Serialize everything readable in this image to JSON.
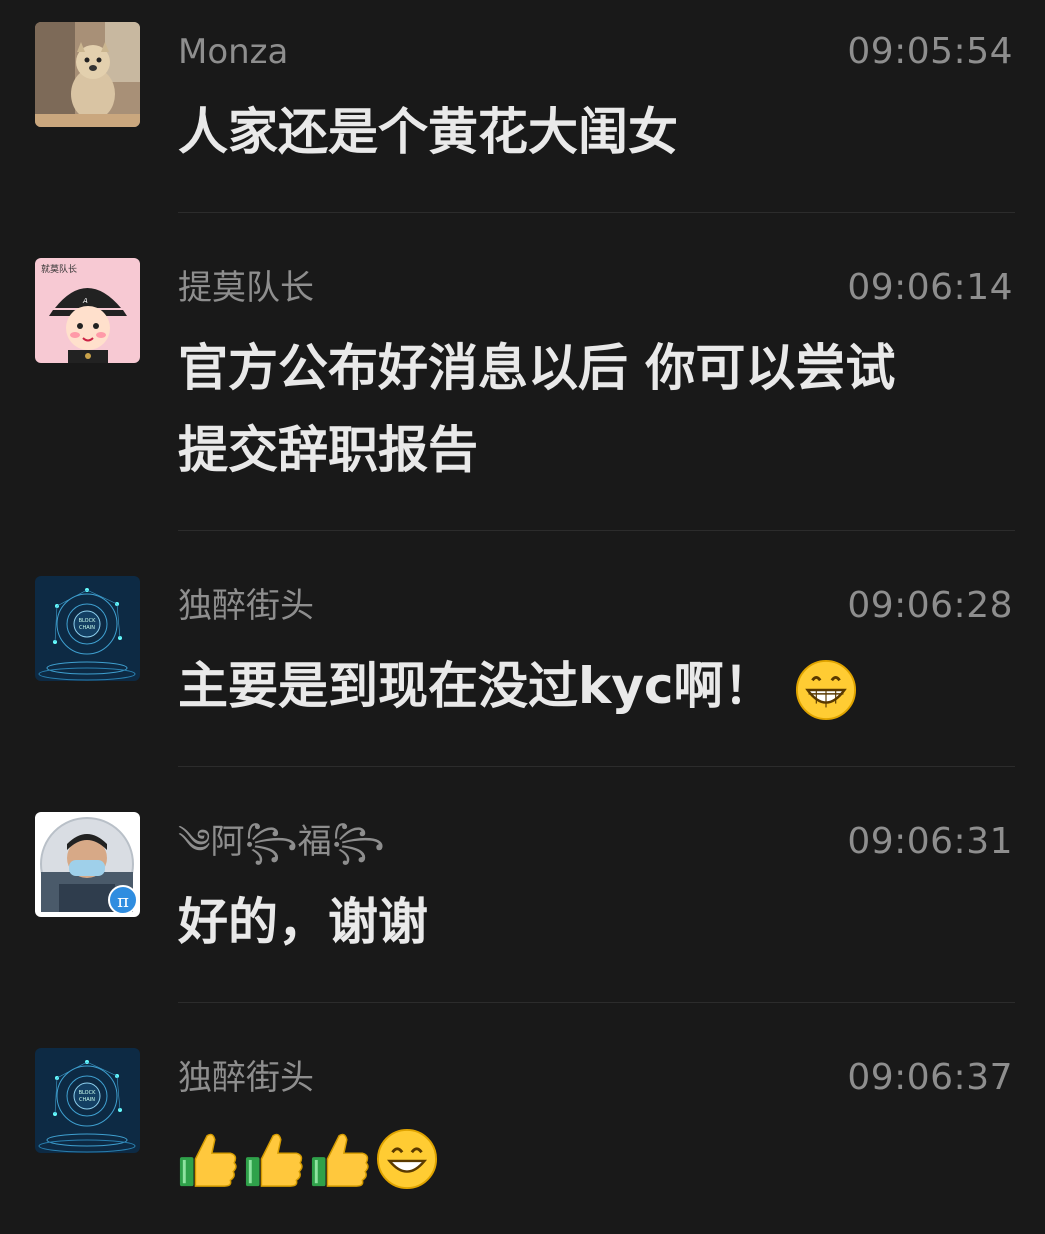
{
  "messages": [
    {
      "name": "Monza",
      "time": "09:05:54",
      "text": "人家还是个黄花大闺女",
      "avatar_icon": "dog-photo-avatar"
    },
    {
      "name": "提莫队长",
      "time": "09:06:14",
      "text_line1": "官方公布好消息以后 你可以尝试",
      "text_line2": "提交辞职报告",
      "avatar_icon": "cartoon-boy-avatar",
      "avatar_label": "就莫队长"
    },
    {
      "name": "独醉街头",
      "time": "09:06:28",
      "text": "主要是到现在没过kyc啊！",
      "emoji": "grinning-face-icon",
      "avatar_icon": "blockchain-avatar",
      "avatar_label_1": "BLOCK",
      "avatar_label_2": "CHAIN"
    },
    {
      "name": "༄阿꧂福꧂",
      "time": "09:06:31",
      "text": "好的，谢谢",
      "avatar_icon": "masked-man-avatar",
      "badge": "π"
    },
    {
      "name": "独醉街头",
      "time": "09:06:37",
      "emojis": [
        "thumbs-up-icon",
        "thumbs-up-icon",
        "thumbs-up-icon",
        "smiling-face-icon"
      ],
      "avatar_icon": "blockchain-avatar",
      "avatar_label_1": "BLOCK",
      "avatar_label_2": "CHAIN"
    }
  ],
  "colors": {
    "background": "#191919",
    "name": "#8e8e8e",
    "text": "#e9e9e9",
    "divider": "#2c2c2c"
  }
}
